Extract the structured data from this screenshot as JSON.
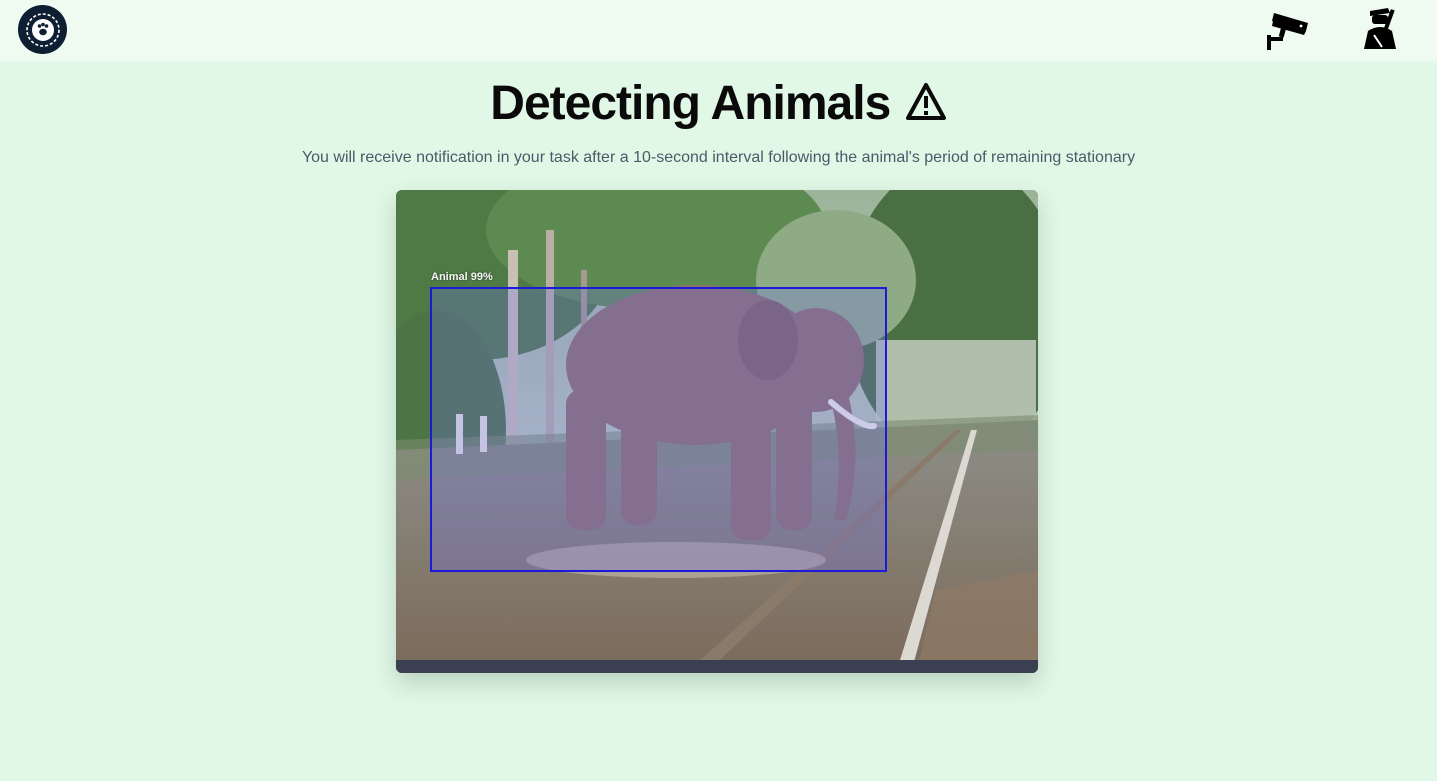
{
  "header": {
    "logo_icon": "paw-logo-icon",
    "nav": [
      {
        "icon": "cctv-camera-icon"
      },
      {
        "icon": "forest-guard-icon"
      }
    ]
  },
  "main": {
    "title": "Detecting Animals",
    "title_icon": "warning-triangle-icon",
    "subtitle": "You will receive notification in your task after a 10-second interval following the animal's period of remaining stationary"
  },
  "feed": {
    "detection_label": "Animal 99%",
    "box_color": "#1a1ad8"
  },
  "colors": {
    "page_background": "#e2f8e7",
    "header_background": "#effbf1",
    "title": "#0a0a0a",
    "subtitle": "#4a5a6a"
  }
}
